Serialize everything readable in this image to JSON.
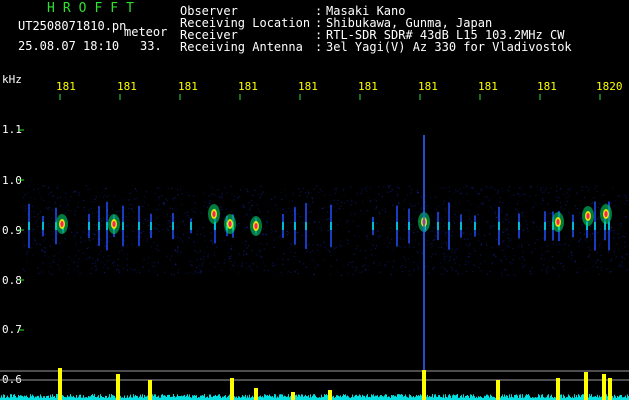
{
  "app": {
    "title": "HROFFT",
    "filename": "UT2508071810.pn",
    "mode_label": "meteor",
    "datetime": "25.08.07 18:10",
    "count": "33."
  },
  "info": [
    {
      "key": "Observer",
      "sep": ":",
      "value": "Masaki Kano"
    },
    {
      "key": "Receiving Location",
      "sep": ":",
      "value": "Shibukawa, Gunma, Japan"
    },
    {
      "key": "Receiver",
      "sep": ":",
      "value": "RTL-SDR SDR# 43dB L15 103.2MHz CW"
    },
    {
      "key": "Receiving Antenna",
      "sep": ":",
      "value": "3el Yagi(V) Az 330 for Vladivostok"
    }
  ],
  "y_axis": {
    "unit": "kHz",
    "ticks": [
      "1.1",
      "1.0",
      "0.9",
      "0.8",
      "0.7",
      "0.6"
    ]
  },
  "x_axis": {
    "ticks": [
      "181",
      "181",
      "181",
      "181",
      "181",
      "181",
      "181",
      "181",
      "181",
      "1820"
    ]
  },
  "colors": {
    "title": "#2fe02f",
    "text": "#ffffff",
    "time_ticks": "#ffff00",
    "axis": "#2fe02f",
    "background": "#000000",
    "activity": "#ffff00",
    "noise": "#00e0e0"
  }
}
